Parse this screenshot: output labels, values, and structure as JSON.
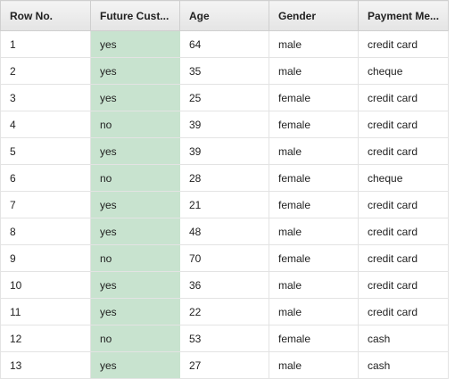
{
  "table": {
    "columns": [
      {
        "label": "Row No."
      },
      {
        "label": "Future Cust..."
      },
      {
        "label": "Age"
      },
      {
        "label": "Gender"
      },
      {
        "label": "Payment Me..."
      }
    ],
    "highlight_color": "#c8e3cf",
    "rows": [
      [
        "1",
        "yes",
        "64",
        "male",
        "credit card"
      ],
      [
        "2",
        "yes",
        "35",
        "male",
        "cheque"
      ],
      [
        "3",
        "yes",
        "25",
        "female",
        "credit card"
      ],
      [
        "4",
        "no",
        "39",
        "female",
        "credit card"
      ],
      [
        "5",
        "yes",
        "39",
        "male",
        "credit card"
      ],
      [
        "6",
        "no",
        "28",
        "female",
        "cheque"
      ],
      [
        "7",
        "yes",
        "21",
        "female",
        "credit card"
      ],
      [
        "8",
        "yes",
        "48",
        "male",
        "credit card"
      ],
      [
        "9",
        "no",
        "70",
        "female",
        "credit card"
      ],
      [
        "10",
        "yes",
        "36",
        "male",
        "credit card"
      ],
      [
        "11",
        "yes",
        "22",
        "male",
        "credit card"
      ],
      [
        "12",
        "no",
        "53",
        "female",
        "cash"
      ],
      [
        "13",
        "yes",
        "27",
        "male",
        "cash"
      ]
    ]
  }
}
